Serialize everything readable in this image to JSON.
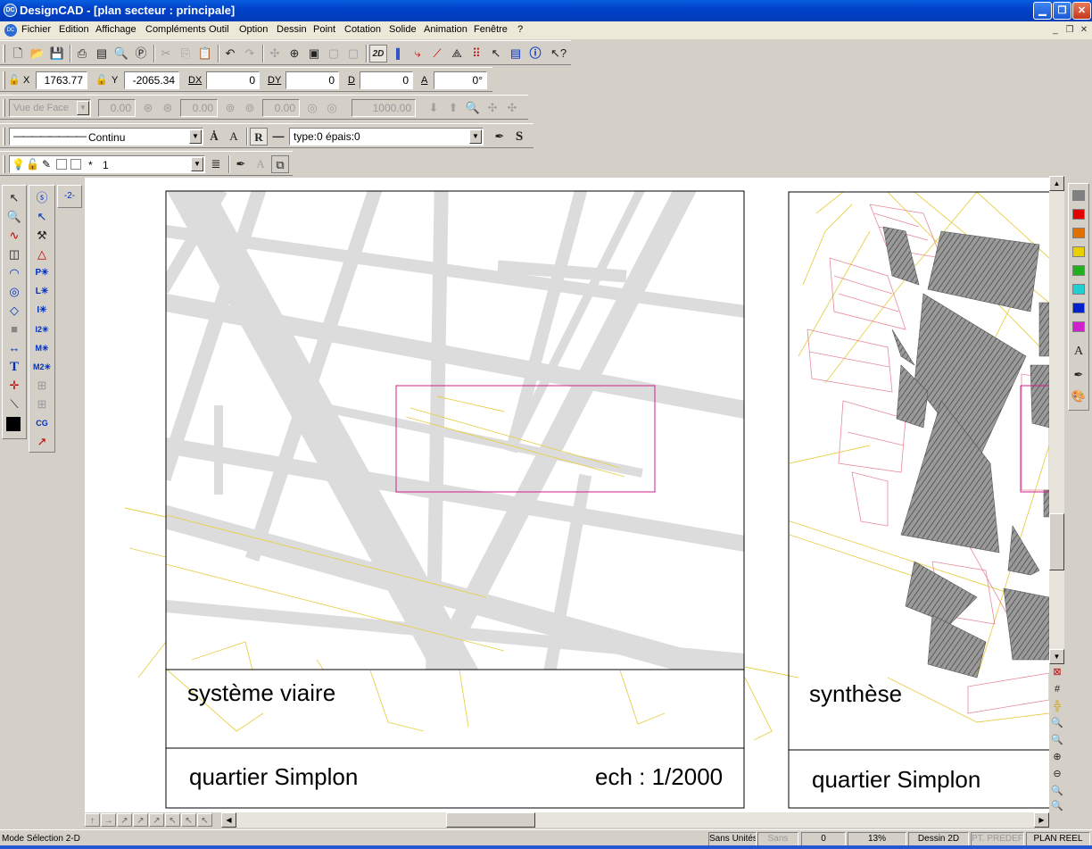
{
  "window": {
    "title": "DesignCAD - [plan secteur : principale]",
    "app_badge": "DC"
  },
  "menu": [
    "Fichier",
    "Edition",
    "Affichage",
    "Compléments",
    "Outil",
    "Option",
    "Dessin",
    "Point",
    "Cotation",
    "Solide",
    "Animation",
    "Fenêtre",
    "?"
  ],
  "coords": {
    "x_label": "X",
    "x_value": "1763.77",
    "y_label": "Y",
    "y_value": "-2065.34",
    "dx_label": "DX",
    "dx_value": "0",
    "dy_label": "DY",
    "dy_value": "0",
    "d_label": "D",
    "d_value": "0",
    "a_label": "A",
    "a_value": "0°"
  },
  "view_toolbar": {
    "view": "Vue de Face",
    "v1": "0.00",
    "v2": "0.00",
    "v3": "0.00",
    "v4": "1000.00"
  },
  "line_toolbar": {
    "style": "Continu",
    "style_sample": "————————",
    "type_info": "type:0 épais:0",
    "r_label": "R",
    "s_label": "S",
    "a_label": "A"
  },
  "layer_toolbar": {
    "marker": "*",
    "layer": "1"
  },
  "drawing": {
    "panel1": {
      "title": "système viaire",
      "subtitle": "quartier Simplon",
      "scale": "ech : 1/2000"
    },
    "panel2": {
      "title": "synthèse",
      "subtitle": "quartier Simplon"
    }
  },
  "palette_right_text": "A",
  "colors": {
    "swatches": [
      "#808080",
      "#e00000",
      "#e07000",
      "#e8d000",
      "#20b020",
      "#20d0d0",
      "#0020d0",
      "#d020d0"
    ],
    "road": "#dcdcdc",
    "road_edge": "#e6d04a",
    "selection": "#d0208c",
    "parcel": "#e88a9a",
    "building": "#707070"
  },
  "status": {
    "mode": "Mode Sélection 2-D",
    "units": "Sans Unités",
    "sans": "Sans",
    "count": "0",
    "zoom": "13%",
    "dessin": "Dessin 2D",
    "ptpredef": "PT. PREDEF",
    "planreel": "PLAN REEL"
  },
  "icons": {
    "main_toolbar": [
      "new-icon",
      "open-icon",
      "save-icon",
      "print-icon",
      "print-setup-icon",
      "preview-icon",
      "page-icon",
      "cut-icon",
      "copy-icon",
      "paste-icon",
      "undo-icon",
      "redo-icon",
      "snap-icon",
      "insert-icon",
      "save-view-icon",
      "view-icon",
      "view2-icon",
      "mode-2d-icon",
      "parallel-icon",
      "arrow-red-icon",
      "line-point-icon",
      "triangle-icon",
      "select-points-icon",
      "cursor-point-icon",
      "window-icon",
      "info-icon",
      "help-icon"
    ],
    "left_palette": [
      "arrow-select-icon",
      "zoom-icon",
      "curve-icon",
      "box-icon",
      "arc-icon",
      "circle-icon",
      "polygon-icon",
      "fill-icon",
      "dimension-icon",
      "text-icon",
      "point-icon",
      "line-icon",
      "color-icon"
    ],
    "snap_palette": [
      "snap-circle-icon",
      "snap-arrow-icon",
      "snap-tool-icon",
      "snap-shape-icon",
      "snap-p-icon",
      "snap-l-icon",
      "snap-i-icon",
      "snap-i2-icon",
      "snap-m-icon",
      "snap-m2-icon",
      "snap-grid-icon",
      "snap-grid2-icon",
      "snap-cg-icon",
      "snap-curve-icon"
    ]
  }
}
